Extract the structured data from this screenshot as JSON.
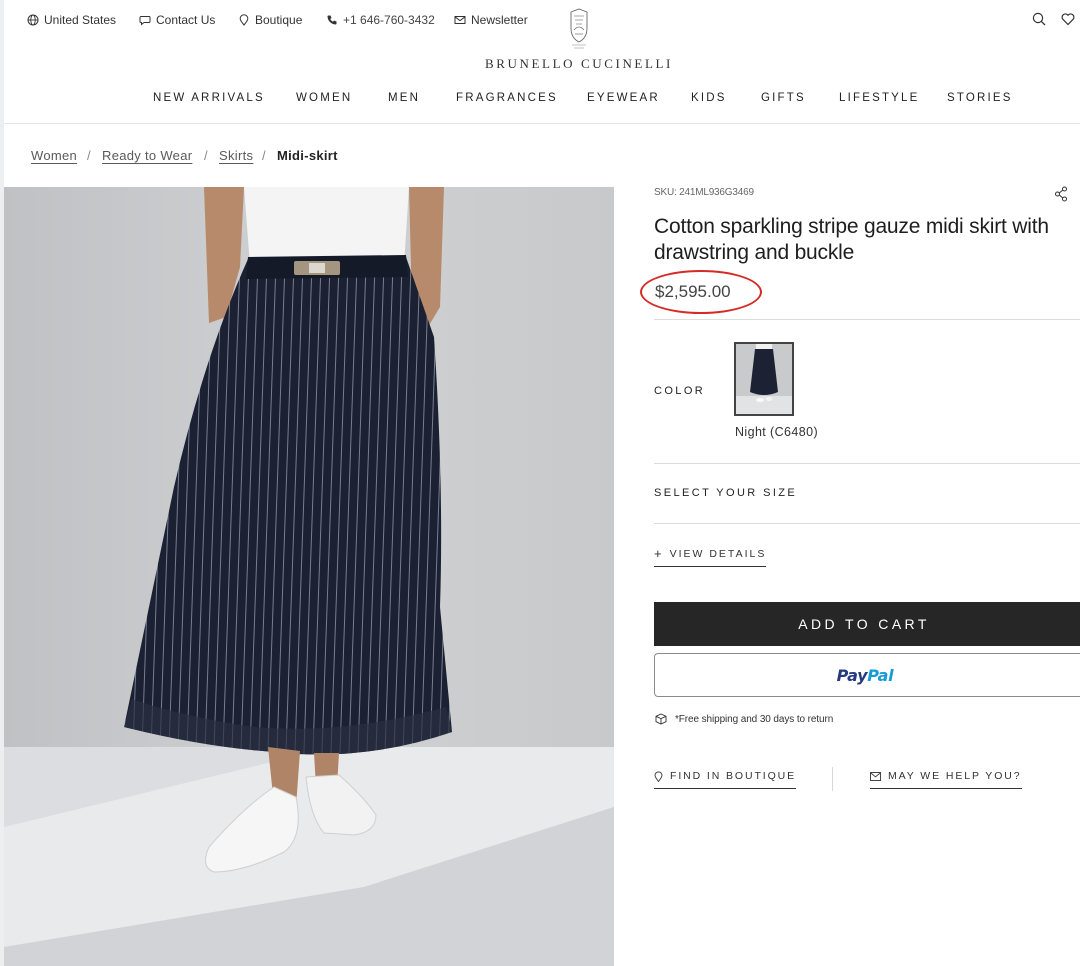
{
  "topbar": {
    "region": "United States",
    "contact": "Contact Us",
    "boutique": "Boutique",
    "phone": "+1 646-760-3432",
    "newsletter": "Newsletter"
  },
  "brand": {
    "name": "BRUNELLO CUCINELLI"
  },
  "nav": [
    "NEW ARRIVALS",
    "WOMEN",
    "MEN",
    "FRAGRANCES",
    "EYEWEAR",
    "KIDS",
    "GIFTS",
    "LIFESTYLE",
    "STORIES"
  ],
  "breadcrumb": {
    "items": [
      "Women",
      "Ready to Wear",
      "Skirts"
    ],
    "separator": "/",
    "current": "Midi-skirt"
  },
  "product": {
    "sku": "SKU: 241ML936G3469",
    "title": "Cotton sparkling stripe gauze midi skirt with drawstring and buckle",
    "price": "$2,595.00",
    "color_label": "COLOR",
    "color_name": "Night (C6480)",
    "size_label": "SELECT YOUR SIZE",
    "details_label": "VIEW DETAILS",
    "add_to_cart": "ADD TO CART",
    "paypal_part1": "Pay",
    "paypal_part2": "Pal",
    "shipping_note": "*Free shipping and 30 days to return",
    "find_in_boutique": "FIND IN BOUTIQUE",
    "help": "MAY WE HELP YOU?"
  },
  "colors": {
    "annotation_ring": "#d52b27",
    "cart_button": "#262626",
    "paypal_dark": "#253b80",
    "paypal_light": "#179bd7",
    "skirt": "#1c2233"
  },
  "icons": [
    "globe-icon",
    "chat-icon",
    "location-pin-icon",
    "phone-icon",
    "mail-icon",
    "brand-crest-icon",
    "search-icon",
    "heart-icon",
    "share-icon",
    "plus-icon",
    "box-icon"
  ]
}
